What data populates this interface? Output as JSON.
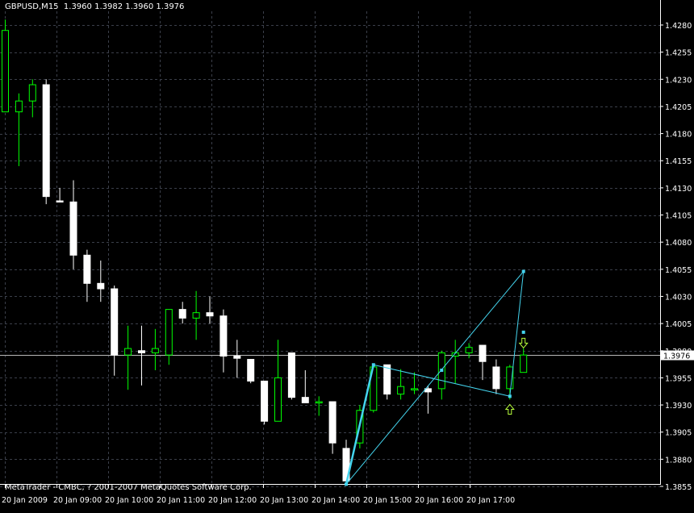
{
  "header": {
    "symbol": "GBPUSD,M15",
    "quote": "1.3960 1.3982 1.3960 1.3976"
  },
  "footer": {
    "copyright": "MetaTrader - CMBC, ? 2001-2007 MetaQuotes Software Corp."
  },
  "colors": {
    "background": "#000000",
    "grid": "#3b3f4a",
    "axis": "#ffffff",
    "bull_body": "#000000",
    "bear_body": "#ffffff",
    "wick_up": "#00ff00",
    "wick_down": "#ffffff",
    "pattern_line": "#44d4ee",
    "arrow": "#b8ff3c",
    "current_price_line": "#b8b8b8"
  },
  "chart_data": {
    "type": "candlestick",
    "symbol": "GBPUSD",
    "timeframe": "M15",
    "current_price": 1.3976,
    "y_ticks": [
      "1.4280",
      "1.4255",
      "1.4230",
      "1.4205",
      "1.4180",
      "1.4155",
      "1.4130",
      "1.4105",
      "1.4080",
      "1.4055",
      "1.4030",
      "1.4005",
      "1.3980",
      "1.3955",
      "1.3930",
      "1.3905",
      "1.3880",
      "1.3855"
    ],
    "x_ticks": [
      "20 Jan 2009",
      "20 Jan 09:00",
      "20 Jan 10:00",
      "20 Jan 11:00",
      "20 Jan 12:00",
      "20 Jan 13:00",
      "20 Jan 14:00",
      "20 Jan 15:00",
      "20 Jan 16:00",
      "20 Jan 17:00"
    ],
    "candles": [
      {
        "o": 1.42,
        "h": 1.4285,
        "l": 1.42,
        "c": 1.4275
      },
      {
        "o": 1.42,
        "h": 1.4217,
        "l": 1.415,
        "c": 1.421
      },
      {
        "o": 1.421,
        "h": 1.423,
        "l": 1.4195,
        "c": 1.4225
      },
      {
        "o": 1.4225,
        "h": 1.423,
        "l": 1.4115,
        "c": 1.4122
      },
      {
        "o": 1.4118,
        "h": 1.413,
        "l": 1.4118,
        "c": 1.4117
      },
      {
        "o": 1.4117,
        "h": 1.4137,
        "l": 1.4055,
        "c": 1.4068
      },
      {
        "o": 1.4068,
        "h": 1.4073,
        "l": 1.4025,
        "c": 1.4042
      },
      {
        "o": 1.4042,
        "h": 1.4063,
        "l": 1.4025,
        "c": 1.4037
      },
      {
        "o": 1.4037,
        "h": 1.404,
        "l": 1.3957,
        "c": 1.3976
      },
      {
        "o": 1.3976,
        "h": 1.4003,
        "l": 1.3944,
        "c": 1.3982
      },
      {
        "o": 1.398,
        "h": 1.4003,
        "l": 1.3948,
        "c": 1.3978
      },
      {
        "o": 1.3978,
        "h": 1.4,
        "l": 1.3962,
        "c": 1.3982
      },
      {
        "o": 1.3976,
        "h": 1.4018,
        "l": 1.3967,
        "c": 1.4018
      },
      {
        "o": 1.4018,
        "h": 1.4025,
        "l": 1.4005,
        "c": 1.401
      },
      {
        "o": 1.401,
        "h": 1.4035,
        "l": 1.399,
        "c": 1.4015
      },
      {
        "o": 1.4015,
        "h": 1.403,
        "l": 1.4005,
        "c": 1.4012
      },
      {
        "o": 1.4012,
        "h": 1.4018,
        "l": 1.396,
        "c": 1.3975
      },
      {
        "o": 1.3975,
        "h": 1.399,
        "l": 1.3955,
        "c": 1.3973
      },
      {
        "o": 1.3972,
        "h": 1.3972,
        "l": 1.395,
        "c": 1.3952
      },
      {
        "o": 1.3952,
        "h": 1.3952,
        "l": 1.3912,
        "c": 1.3915
      },
      {
        "o": 1.3915,
        "h": 1.399,
        "l": 1.3915,
        "c": 1.3955
      },
      {
        "o": 1.3978,
        "h": 1.3978,
        "l": 1.3935,
        "c": 1.3937
      },
      {
        "o": 1.3937,
        "h": 1.3962,
        "l": 1.3932,
        "c": 1.3932
      },
      {
        "o": 1.3932,
        "h": 1.3938,
        "l": 1.392,
        "c": 1.3933
      },
      {
        "o": 1.3933,
        "h": 1.3933,
        "l": 1.3885,
        "c": 1.3895
      },
      {
        "o": 1.389,
        "h": 1.3898,
        "l": 1.3857,
        "c": 1.386
      },
      {
        "o": 1.3895,
        "h": 1.393,
        "l": 1.389,
        "c": 1.3925
      },
      {
        "o": 1.3925,
        "h": 1.3967,
        "l": 1.3923,
        "c": 1.3965
      },
      {
        "o": 1.3967,
        "h": 1.3967,
        "l": 1.3935,
        "c": 1.394
      },
      {
        "o": 1.394,
        "h": 1.3963,
        "l": 1.3935,
        "c": 1.3947
      },
      {
        "o": 1.3945,
        "h": 1.396,
        "l": 1.394,
        "c": 1.3945
      },
      {
        "o": 1.3945,
        "h": 1.3948,
        "l": 1.3922,
        "c": 1.3942
      },
      {
        "o": 1.3945,
        "h": 1.398,
        "l": 1.3935,
        "c": 1.3978
      },
      {
        "o": 1.3975,
        "h": 1.399,
        "l": 1.395,
        "c": 1.3978
      },
      {
        "o": 1.3978,
        "h": 1.3987,
        "l": 1.3973,
        "c": 1.3983
      },
      {
        "o": 1.3985,
        "h": 1.3985,
        "l": 1.3953,
        "c": 1.397
      },
      {
        "o": 1.3965,
        "h": 1.3972,
        "l": 1.394,
        "c": 1.3945
      },
      {
        "o": 1.3945,
        "h": 1.3967,
        "l": 1.3935,
        "c": 1.3965
      },
      {
        "o": 1.396,
        "h": 1.3982,
        "l": 1.396,
        "c": 1.3976
      }
    ],
    "pattern_points": [
      {
        "bar": 25,
        "price": 1.3857
      },
      {
        "bar": 27,
        "price": 1.3967
      },
      {
        "bar": 37,
        "price": 1.3938
      },
      {
        "bar": 38,
        "price": 1.4053
      }
    ],
    "pattern_segments": [
      [
        0,
        1
      ],
      [
        1,
        2
      ],
      [
        2,
        3
      ],
      [
        0,
        3
      ]
    ],
    "pattern_markers": [
      {
        "bar": 32,
        "price": 1.3962
      },
      {
        "bar": 38,
        "price": 1.3997
      }
    ],
    "arrows": [
      {
        "bar": 37,
        "price": 1.3926,
        "direction": "up"
      },
      {
        "bar": 38,
        "price": 1.3987,
        "direction": "down"
      }
    ],
    "grid": true,
    "y_axis_position": "right"
  }
}
